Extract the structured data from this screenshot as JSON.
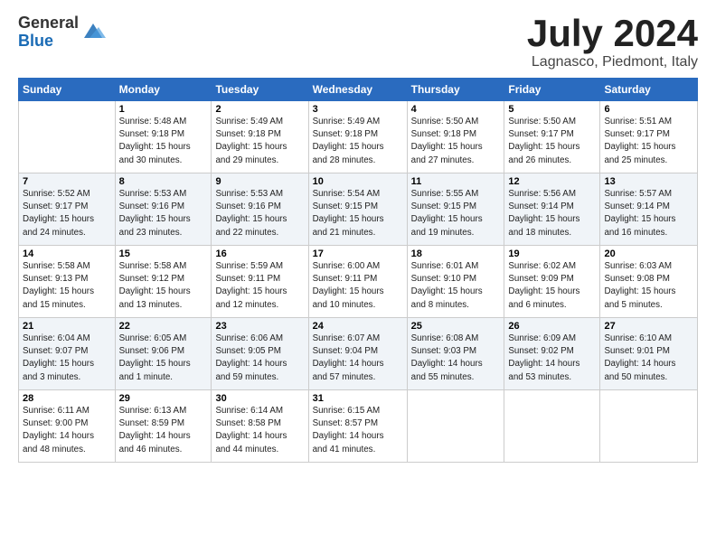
{
  "logo": {
    "general": "General",
    "blue": "Blue"
  },
  "header": {
    "month": "July 2024",
    "location": "Lagnasco, Piedmont, Italy"
  },
  "days_of_week": [
    "Sunday",
    "Monday",
    "Tuesday",
    "Wednesday",
    "Thursday",
    "Friday",
    "Saturday"
  ],
  "weeks": [
    [
      {
        "day": "",
        "info": ""
      },
      {
        "day": "1",
        "info": "Sunrise: 5:48 AM\nSunset: 9:18 PM\nDaylight: 15 hours\nand 30 minutes."
      },
      {
        "day": "2",
        "info": "Sunrise: 5:49 AM\nSunset: 9:18 PM\nDaylight: 15 hours\nand 29 minutes."
      },
      {
        "day": "3",
        "info": "Sunrise: 5:49 AM\nSunset: 9:18 PM\nDaylight: 15 hours\nand 28 minutes."
      },
      {
        "day": "4",
        "info": "Sunrise: 5:50 AM\nSunset: 9:18 PM\nDaylight: 15 hours\nand 27 minutes."
      },
      {
        "day": "5",
        "info": "Sunrise: 5:50 AM\nSunset: 9:17 PM\nDaylight: 15 hours\nand 26 minutes."
      },
      {
        "day": "6",
        "info": "Sunrise: 5:51 AM\nSunset: 9:17 PM\nDaylight: 15 hours\nand 25 minutes."
      }
    ],
    [
      {
        "day": "7",
        "info": "Sunrise: 5:52 AM\nSunset: 9:17 PM\nDaylight: 15 hours\nand 24 minutes."
      },
      {
        "day": "8",
        "info": "Sunrise: 5:53 AM\nSunset: 9:16 PM\nDaylight: 15 hours\nand 23 minutes."
      },
      {
        "day": "9",
        "info": "Sunrise: 5:53 AM\nSunset: 9:16 PM\nDaylight: 15 hours\nand 22 minutes."
      },
      {
        "day": "10",
        "info": "Sunrise: 5:54 AM\nSunset: 9:15 PM\nDaylight: 15 hours\nand 21 minutes."
      },
      {
        "day": "11",
        "info": "Sunrise: 5:55 AM\nSunset: 9:15 PM\nDaylight: 15 hours\nand 19 minutes."
      },
      {
        "day": "12",
        "info": "Sunrise: 5:56 AM\nSunset: 9:14 PM\nDaylight: 15 hours\nand 18 minutes."
      },
      {
        "day": "13",
        "info": "Sunrise: 5:57 AM\nSunset: 9:14 PM\nDaylight: 15 hours\nand 16 minutes."
      }
    ],
    [
      {
        "day": "14",
        "info": "Sunrise: 5:58 AM\nSunset: 9:13 PM\nDaylight: 15 hours\nand 15 minutes."
      },
      {
        "day": "15",
        "info": "Sunrise: 5:58 AM\nSunset: 9:12 PM\nDaylight: 15 hours\nand 13 minutes."
      },
      {
        "day": "16",
        "info": "Sunrise: 5:59 AM\nSunset: 9:11 PM\nDaylight: 15 hours\nand 12 minutes."
      },
      {
        "day": "17",
        "info": "Sunrise: 6:00 AM\nSunset: 9:11 PM\nDaylight: 15 hours\nand 10 minutes."
      },
      {
        "day": "18",
        "info": "Sunrise: 6:01 AM\nSunset: 9:10 PM\nDaylight: 15 hours\nand 8 minutes."
      },
      {
        "day": "19",
        "info": "Sunrise: 6:02 AM\nSunset: 9:09 PM\nDaylight: 15 hours\nand 6 minutes."
      },
      {
        "day": "20",
        "info": "Sunrise: 6:03 AM\nSunset: 9:08 PM\nDaylight: 15 hours\nand 5 minutes."
      }
    ],
    [
      {
        "day": "21",
        "info": "Sunrise: 6:04 AM\nSunset: 9:07 PM\nDaylight: 15 hours\nand 3 minutes."
      },
      {
        "day": "22",
        "info": "Sunrise: 6:05 AM\nSunset: 9:06 PM\nDaylight: 15 hours\nand 1 minute."
      },
      {
        "day": "23",
        "info": "Sunrise: 6:06 AM\nSunset: 9:05 PM\nDaylight: 14 hours\nand 59 minutes."
      },
      {
        "day": "24",
        "info": "Sunrise: 6:07 AM\nSunset: 9:04 PM\nDaylight: 14 hours\nand 57 minutes."
      },
      {
        "day": "25",
        "info": "Sunrise: 6:08 AM\nSunset: 9:03 PM\nDaylight: 14 hours\nand 55 minutes."
      },
      {
        "day": "26",
        "info": "Sunrise: 6:09 AM\nSunset: 9:02 PM\nDaylight: 14 hours\nand 53 minutes."
      },
      {
        "day": "27",
        "info": "Sunrise: 6:10 AM\nSunset: 9:01 PM\nDaylight: 14 hours\nand 50 minutes."
      }
    ],
    [
      {
        "day": "28",
        "info": "Sunrise: 6:11 AM\nSunset: 9:00 PM\nDaylight: 14 hours\nand 48 minutes."
      },
      {
        "day": "29",
        "info": "Sunrise: 6:13 AM\nSunset: 8:59 PM\nDaylight: 14 hours\nand 46 minutes."
      },
      {
        "day": "30",
        "info": "Sunrise: 6:14 AM\nSunset: 8:58 PM\nDaylight: 14 hours\nand 44 minutes."
      },
      {
        "day": "31",
        "info": "Sunrise: 6:15 AM\nSunset: 8:57 PM\nDaylight: 14 hours\nand 41 minutes."
      },
      {
        "day": "",
        "info": ""
      },
      {
        "day": "",
        "info": ""
      },
      {
        "day": "",
        "info": ""
      }
    ]
  ]
}
